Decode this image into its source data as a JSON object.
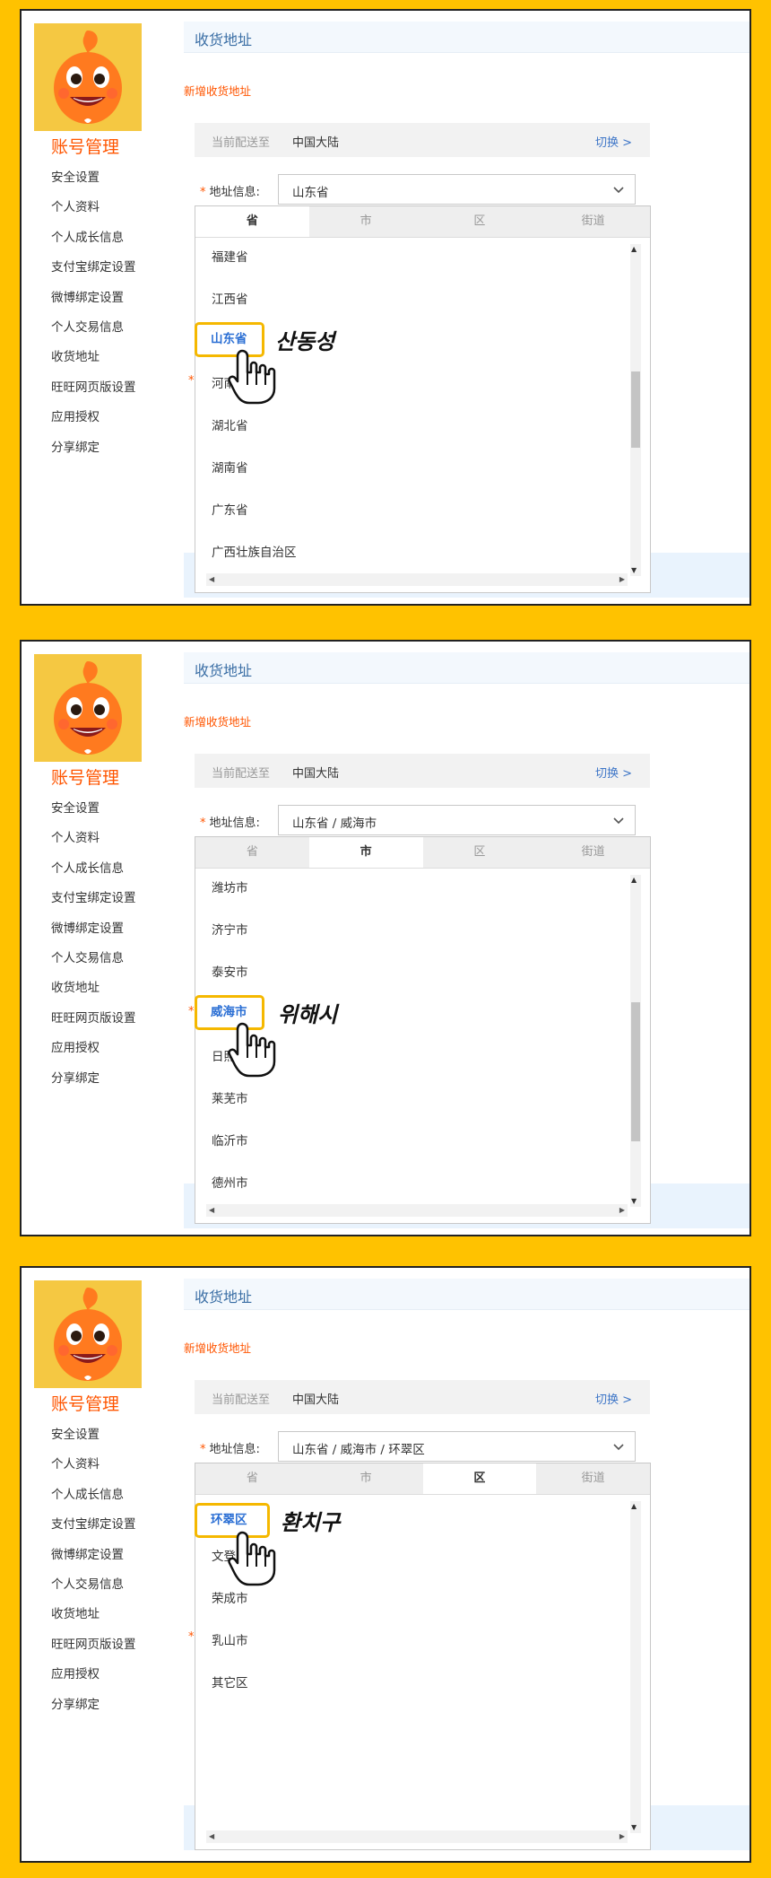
{
  "common": {
    "account_title": "账号管理",
    "menu": [
      "安全设置",
      "个人资料",
      "个人成长信息",
      "支付宝绑定设置",
      "微博绑定设置",
      "个人交易信息",
      "收货地址",
      "旺旺网页版设置",
      "应用授权",
      "分享绑定"
    ],
    "page_heading": "收货地址",
    "new_address_link": "新增收货地址",
    "delivery_label": "当前配送至",
    "delivery_value": "中国大陆",
    "switch_link": "切换 >",
    "address_label": "地址信息:",
    "required_star": "*",
    "tabs": [
      "省",
      "市",
      "区",
      "街道"
    ],
    "colors": {
      "frame": "#ffc200",
      "accent": "#ff5500",
      "link": "#3d75c7",
      "highlight": "#f5b800"
    }
  },
  "panels": [
    {
      "address_value": "山东省",
      "active_tab": "省",
      "options": [
        "福建省",
        "江西省",
        "山东省",
        "河南省",
        "湖北省",
        "湖南省",
        "广东省",
        "广西壮族自治区"
      ],
      "highlighted": "山东省",
      "annotation": "산동성",
      "scroll_position": 0.4
    },
    {
      "address_value": "山东省 / 威海市",
      "active_tab": "市",
      "options": [
        "潍坊市",
        "济宁市",
        "泰安市",
        "威海市",
        "日照市",
        "莱芜市",
        "临沂市",
        "德州市"
      ],
      "highlighted": "威海市",
      "annotation": "위해시",
      "scroll_position": 0.4
    },
    {
      "address_value": "山东省 / 威海市 / 环翠区",
      "active_tab": "区",
      "options": [
        "环翠区",
        "文登区",
        "荣成市",
        "乳山市",
        "其它区"
      ],
      "highlighted": "环翠区",
      "annotation": "환치구",
      "scroll_position": 0
    }
  ]
}
